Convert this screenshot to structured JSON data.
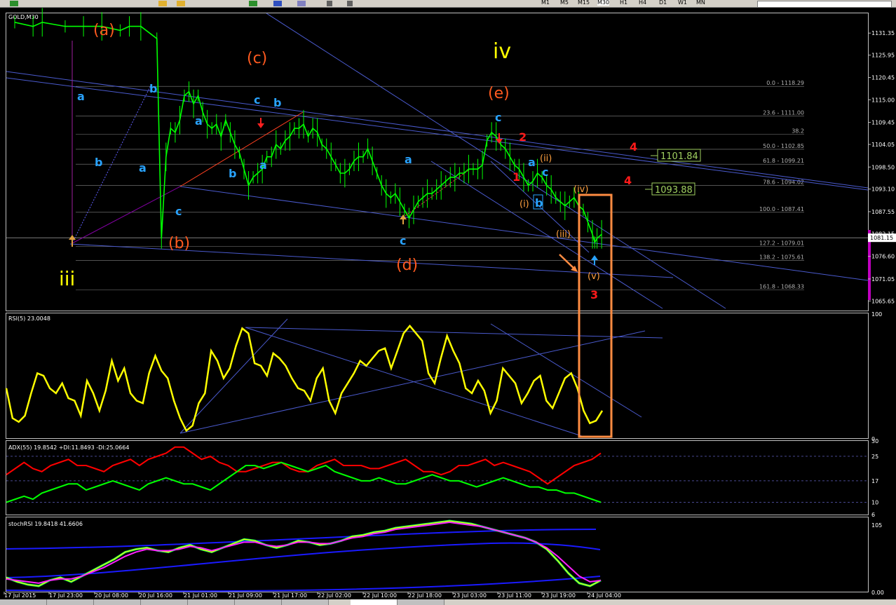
{
  "toolbar": {
    "timeframes": [
      "M1",
      "M5",
      "M15",
      "M30",
      "H1",
      "H4",
      "D1",
      "W1",
      "MN"
    ],
    "active_timeframe": "M30"
  },
  "window": {
    "symbol_label": "GOLD,M30"
  },
  "colors": {
    "background": "#000000",
    "candle": "#00ff00",
    "channel": "#4a5acd",
    "rsi": "#ffff00",
    "adx_red": "#ff0000",
    "adx_green": "#00ff00",
    "highlight_box": "#ff8c42",
    "wave_orange": "#ff5a1f",
    "wave_cyan": "#29a3ff",
    "wave_yellow": "#ffff00",
    "wave_red": "#ff1a1a",
    "fib": "#b0b0b0"
  },
  "chart_data": [
    {
      "type": "line",
      "name_label": "GOLD,M30",
      "ylim": [
        1063.3,
        1136.2
      ],
      "y_ticks": [
        "1131.35",
        "1125.95",
        "1120.45",
        "1115.00",
        "1109.45",
        "1104.05",
        "1098.50",
        "1093.10",
        "1087.55",
        "1082.15",
        "1076.60",
        "1071.05",
        "1065.65"
      ],
      "current_price": "1081.15",
      "x_tick_labels": [
        "17 Jul 2015",
        "17 Jul 23:00",
        "20 Jul 08:00",
        "20 Jul 16:00",
        "21 Jul 01:00",
        "21 Jul 09:00",
        "21 Jul 17:00",
        "22 Jul 02:00",
        "22 Jul 10:00",
        "22 Jul 18:00",
        "23 Jul 03:00",
        "23 Jul 11:00",
        "23 Jul 19:00",
        "24 Jul 04:00"
      ],
      "close_path": [
        [
          0,
          1134
        ],
        [
          8,
          1133
        ],
        [
          12,
          1134
        ],
        [
          22,
          1133
        ],
        [
          30,
          1133
        ],
        [
          38,
          1133
        ],
        [
          46,
          1132
        ],
        [
          50,
          1133
        ],
        [
          55,
          1133
        ],
        [
          62,
          1130
        ],
        [
          64,
          1081
        ],
        [
          66,
          1101
        ],
        [
          68,
          1108
        ],
        [
          70,
          1107
        ],
        [
          72,
          1110
        ],
        [
          74,
          1116
        ],
        [
          76,
          1117
        ],
        [
          78,
          1114
        ],
        [
          80,
          1116
        ],
        [
          82,
          1112
        ],
        [
          84,
          1109
        ],
        [
          86,
          1108
        ],
        [
          88,
          1109
        ],
        [
          90,
          1106
        ],
        [
          92,
          1110
        ],
        [
          94,
          1107
        ],
        [
          96,
          1104
        ],
        [
          98,
          1102
        ],
        [
          100,
          1098
        ],
        [
          102,
          1094
        ],
        [
          104,
          1096
        ],
        [
          106,
          1097
        ],
        [
          108,
          1098
        ],
        [
          110,
          1101
        ],
        [
          112,
          1101
        ],
        [
          114,
          1104
        ],
        [
          116,
          1103
        ],
        [
          118,
          1105
        ],
        [
          120,
          1106
        ],
        [
          122,
          1108
        ],
        [
          124,
          1108
        ],
        [
          126,
          1109
        ],
        [
          128,
          1106
        ],
        [
          130,
          1108
        ],
        [
          132,
          1107
        ],
        [
          134,
          1104
        ],
        [
          136,
          1103
        ],
        [
          138,
          1101
        ],
        [
          140,
          1099
        ],
        [
          142,
          1097
        ],
        [
          144,
          1097
        ],
        [
          146,
          1098
        ],
        [
          148,
          1100
        ],
        [
          150,
          1101
        ],
        [
          152,
          1101
        ],
        [
          154,
          1103
        ],
        [
          156,
          1100
        ],
        [
          158,
          1097
        ],
        [
          160,
          1094
        ],
        [
          162,
          1092
        ],
        [
          164,
          1091
        ],
        [
          166,
          1092
        ],
        [
          168,
          1090
        ],
        [
          170,
          1088
        ],
        [
          172,
          1086
        ],
        [
          174,
          1088
        ],
        [
          176,
          1090
        ],
        [
          178,
          1091
        ],
        [
          180,
          1092
        ],
        [
          182,
          1092
        ],
        [
          184,
          1093
        ],
        [
          186,
          1094
        ],
        [
          188,
          1095
        ],
        [
          190,
          1096
        ],
        [
          192,
          1096
        ],
        [
          194,
          1097
        ],
        [
          196,
          1097
        ],
        [
          198,
          1098
        ],
        [
          200,
          1098
        ],
        [
          202,
          1098
        ],
        [
          204,
          1099
        ],
        [
          206,
          1105
        ],
        [
          208,
          1107
        ],
        [
          210,
          1106
        ],
        [
          212,
          1104
        ],
        [
          214,
          1103
        ],
        [
          216,
          1101
        ],
        [
          218,
          1099
        ],
        [
          220,
          1098
        ],
        [
          222,
          1096
        ],
        [
          224,
          1094
        ],
        [
          226,
          1095
        ],
        [
          228,
          1097
        ],
        [
          230,
          1096
        ],
        [
          232,
          1094
        ],
        [
          234,
          1093
        ],
        [
          236,
          1091
        ],
        [
          238,
          1090
        ],
        [
          240,
          1089
        ],
        [
          242,
          1090
        ],
        [
          244,
          1091
        ],
        [
          246,
          1089
        ],
        [
          248,
          1088
        ],
        [
          250,
          1085
        ],
        [
          252,
          1082
        ],
        [
          253,
          1080
        ],
        [
          254,
          1081
        ],
        [
          256,
          1082
        ]
      ]
    },
    {
      "type": "line",
      "name_label": "RSI(5) 23.0048",
      "ylim": [
        0,
        100
      ],
      "y_ticks": [
        "100",
        "0"
      ],
      "series": [
        {
          "values": [
            40,
            16,
            13,
            18,
            36,
            52,
            50,
            40,
            36,
            44,
            32,
            30,
            18,
            46,
            36,
            22,
            38,
            62,
            46,
            56,
            36,
            30,
            28,
            52,
            66,
            54,
            48,
            30,
            16,
            6,
            10,
            28,
            36,
            70,
            62,
            48,
            56,
            74,
            88,
            84,
            60,
            58,
            50,
            68,
            64,
            58,
            48,
            40,
            38,
            30,
            48,
            56,
            30,
            20,
            36,
            44,
            52,
            62,
            58,
            64,
            70,
            72,
            56,
            70,
            84,
            90,
            84,
            78,
            52,
            44,
            64,
            82,
            70,
            60,
            40,
            36,
            46,
            38,
            20,
            30,
            56,
            50,
            44,
            28,
            36,
            46,
            50,
            30,
            24,
            36,
            48,
            52,
            40,
            22,
            12,
            14,
            22
          ]
        }
      ]
    },
    {
      "type": "line",
      "name_label": "ADX(55) 19.8542 +DI:11.8493 -DI:25.0664",
      "ylim": [
        6,
        30
      ],
      "y_ticks": [
        "30",
        "25",
        "17",
        "10",
        "6"
      ],
      "series": [
        {
          "values": [
            19,
            21,
            23,
            21,
            20,
            22,
            23,
            24,
            22,
            22,
            21,
            20,
            22,
            23,
            24,
            22,
            24,
            25,
            26,
            28,
            28,
            26,
            24,
            25,
            23,
            22,
            20,
            20,
            21,
            22,
            23,
            23,
            21,
            20,
            20,
            22,
            23,
            24,
            22,
            22,
            22,
            21,
            21,
            22,
            23,
            24,
            22,
            20,
            20,
            19,
            20,
            22,
            22,
            23,
            24,
            22,
            23,
            22,
            21,
            20,
            18,
            16,
            18,
            20,
            22,
            23,
            24,
            26
          ]
        },
        {
          "values": [
            10,
            11,
            12,
            11,
            13,
            14,
            15,
            16,
            16,
            14,
            15,
            16,
            17,
            16,
            15,
            14,
            16,
            17,
            18,
            17,
            16,
            16,
            15,
            14,
            16,
            18,
            20,
            22,
            22,
            21,
            22,
            23,
            22,
            21,
            20,
            21,
            22,
            20,
            19,
            18,
            17,
            17,
            18,
            17,
            16,
            16,
            17,
            18,
            19,
            18,
            17,
            17,
            16,
            15,
            16,
            17,
            18,
            17,
            16,
            15,
            15,
            14,
            14,
            13,
            13,
            12,
            11,
            10
          ]
        }
      ]
    },
    {
      "type": "line",
      "name_label": "stochRSI 19.8418 41.6606",
      "ylim": [
        0,
        105
      ],
      "y_ticks": [
        "105",
        "0.00"
      ],
      "series": [
        {
          "values": [
            20,
            14,
            10,
            8,
            16,
            20,
            14,
            22,
            30,
            38,
            46,
            56,
            60,
            62,
            58,
            56,
            62,
            66,
            60,
            56,
            62,
            68,
            74,
            72,
            66,
            62,
            66,
            72,
            70,
            66,
            68,
            72,
            78,
            80,
            84,
            86,
            90,
            92,
            94,
            96,
            98,
            100,
            98,
            96,
            92,
            88,
            84,
            80,
            76,
            70,
            60,
            44,
            26,
            12,
            8,
            16
          ]
        },
        {
          "values": [
            18,
            16,
            14,
            12,
            16,
            18,
            18,
            22,
            28,
            34,
            42,
            50,
            56,
            60,
            58,
            58,
            60,
            64,
            62,
            58,
            62,
            66,
            70,
            70,
            66,
            64,
            66,
            70,
            70,
            68,
            68,
            72,
            76,
            78,
            82,
            84,
            88,
            90,
            92,
            94,
            96,
            98,
            96,
            94,
            92,
            88,
            84,
            80,
            76,
            70,
            62,
            50,
            36,
            22,
            14,
            16
          ]
        }
      ]
    }
  ],
  "annotations": {
    "wave_a_major": "(a)",
    "wave_b_major": "(b)",
    "wave_c_major": "(c)",
    "wave_d_major": "(d)",
    "wave_e_major": "(e)",
    "wave_iii": "iii",
    "wave_iv": "iv",
    "small_a1": "a",
    "small_b1": "b",
    "small_b2": "b",
    "small_a2": "a",
    "small_a3": "a",
    "small_b3": "b",
    "small_a4": "a",
    "small_c1": "c",
    "small_c2": "c",
    "small_b4": "b",
    "small_a5": "a",
    "small_c3": "c",
    "small_c4": "c",
    "small_a6": "a",
    "small_b5": "b",
    "small_c5": "c",
    "sub_i": "(i)",
    "sub_ii": "(ii)",
    "sub_iii": "(iii)",
    "sub_iv": "(iv)",
    "sub_v": "(v)",
    "red_1": "1",
    "red_2": "2",
    "red_3": "3",
    "red_4a": "4",
    "red_4b": "4",
    "level_1": "1101.84",
    "level_2": "1093.88"
  },
  "fib_levels": [
    {
      "label": "0.0 - 1118.29",
      "price": 1118.29
    },
    {
      "label": "23.6 - 1111.00",
      "price": 1111.0
    },
    {
      "label": "38.2",
      "price": 1106.5
    },
    {
      "label": "50.0 - 1102.85",
      "price": 1102.85
    },
    {
      "label": "61.8 - 1099.21",
      "price": 1099.21
    },
    {
      "label": "78.6 - 1094.02",
      "price": 1094.02
    },
    {
      "label": "100.0 - 1087.41",
      "price": 1087.41
    },
    {
      "label": "127.2 - 1079.01",
      "price": 1079.01
    },
    {
      "label": "138.2 - 1075.61",
      "price": 1075.61
    },
    {
      "label": "161.8 - 1068.33",
      "price": 1068.33
    }
  ]
}
